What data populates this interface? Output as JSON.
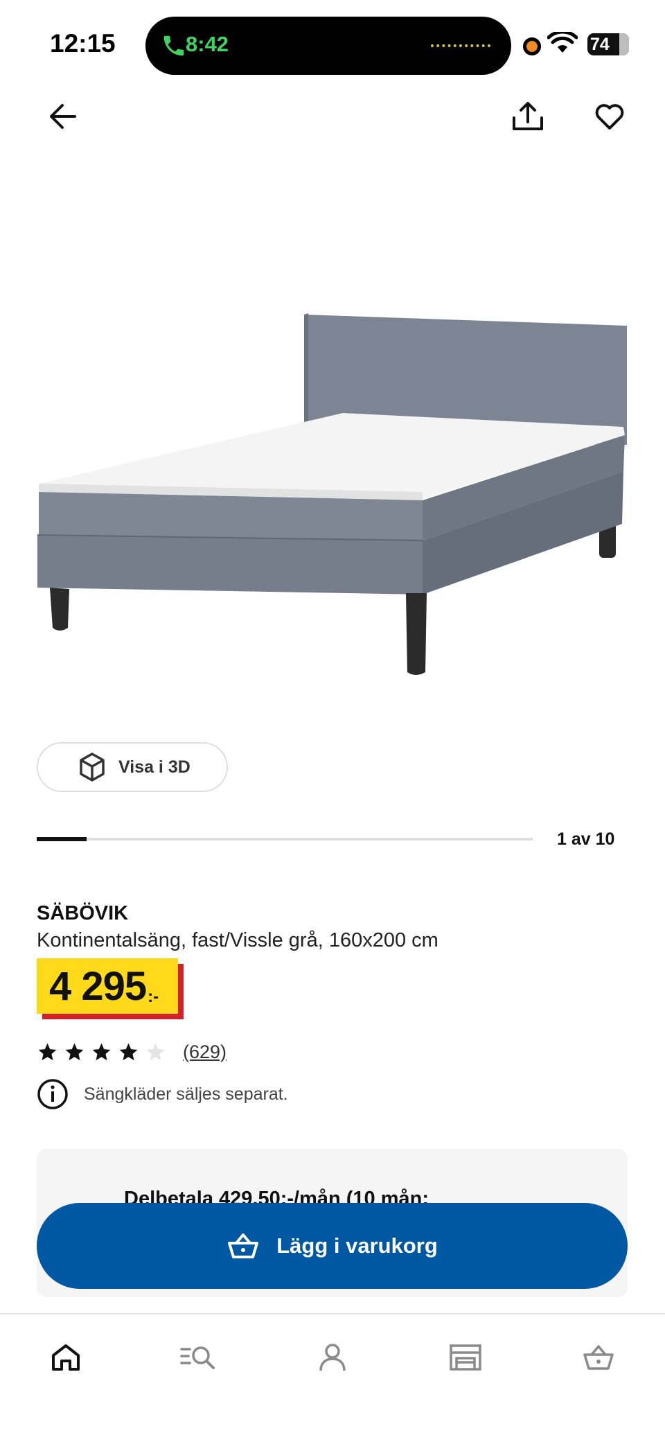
{
  "status_bar": {
    "time": "12:15",
    "call_time": "8:42",
    "battery": "74"
  },
  "toolbar": {
    "back_icon": "arrow-left-icon",
    "share_icon": "share-icon",
    "favorite_icon": "heart-icon"
  },
  "gallery": {
    "view_3d_label": "Visa i 3D",
    "position_label": "1 av 10",
    "progress_fraction": 0.1
  },
  "product": {
    "name": "SÄBÖVIK",
    "description": "Kontinentalsäng, fast/Vissle grå, 160x200 cm",
    "price": "4 295",
    "price_suffix": ":-",
    "rating_stars": 4,
    "rating_max": 5,
    "review_count": "(629)",
    "notice": "Sängkläder säljes separat."
  },
  "finance": {
    "text": "Delbetala 429,50:-/mån (10 mån;"
  },
  "cart_button": {
    "label": "Lägg i varukorg"
  },
  "bottom_nav": {
    "items": [
      "home-icon",
      "search-list-icon",
      "profile-icon",
      "store-icon",
      "cart-icon"
    ]
  },
  "colors": {
    "brand_blue": "#0058a3",
    "price_yellow": "#ffda1a",
    "price_red": "#d42129",
    "call_green": "#3fd361"
  }
}
